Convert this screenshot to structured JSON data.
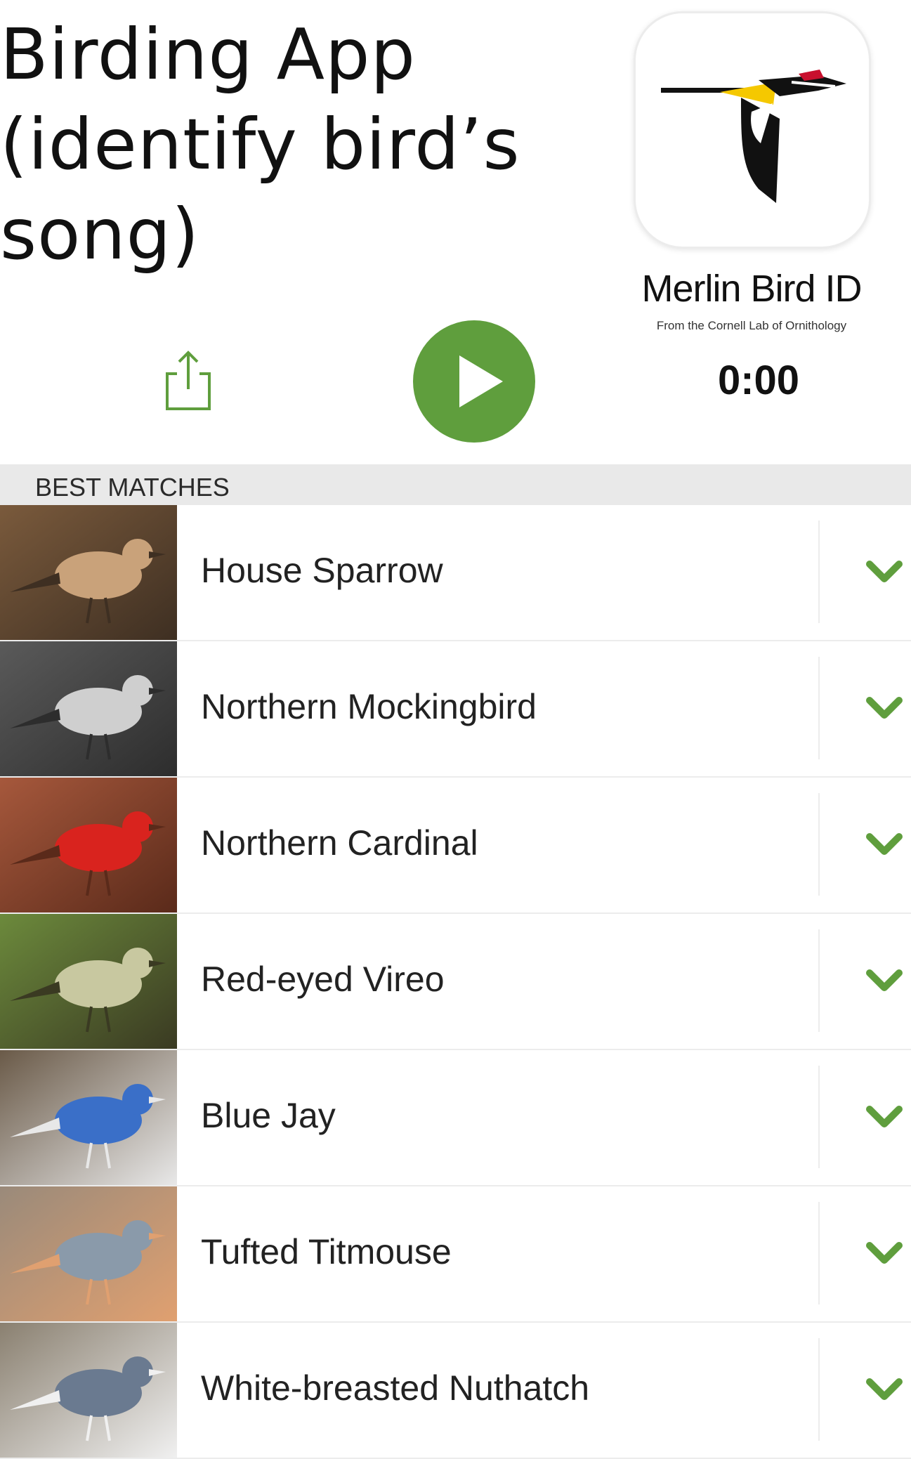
{
  "headline": {
    "line1": "Birding App",
    "line2": "(identify bird’s",
    "line3": "song)"
  },
  "app": {
    "name": "Merlin Bird ID",
    "subtitle": "From the Cornell Lab of Ornithology",
    "icon": "merlin-woodpecker-logo"
  },
  "player": {
    "timer": "0:00",
    "share_icon": "share-icon",
    "play_icon": "play-icon",
    "accent_color": "#5f9e3d"
  },
  "section": {
    "title": "BEST MATCHES"
  },
  "matches": [
    {
      "name": "House Sparrow",
      "photo_colors": [
        "#7a5a3c",
        "#c9a27a",
        "#3e2f22"
      ]
    },
    {
      "name": "Northern Mockingbird",
      "photo_colors": [
        "#5a5a5a",
        "#cfcfcf",
        "#2d2d2d"
      ]
    },
    {
      "name": "Northern Cardinal",
      "photo_colors": [
        "#a6583c",
        "#d9231e",
        "#5a2a1a"
      ]
    },
    {
      "name": "Red-eyed Vireo",
      "photo_colors": [
        "#6c8a3c",
        "#c8c8a0",
        "#3a3a22"
      ]
    },
    {
      "name": "Blue Jay",
      "photo_colors": [
        "#6a5a48",
        "#3a6fc8",
        "#e8e8e8"
      ]
    },
    {
      "name": "Tufted Titmouse",
      "photo_colors": [
        "#9a8a7a",
        "#8a9aaa",
        "#e0a070"
      ]
    },
    {
      "name": "White-breasted Nuthatch",
      "photo_colors": [
        "#8a8070",
        "#6a7a90",
        "#f0f0f0"
      ]
    }
  ]
}
